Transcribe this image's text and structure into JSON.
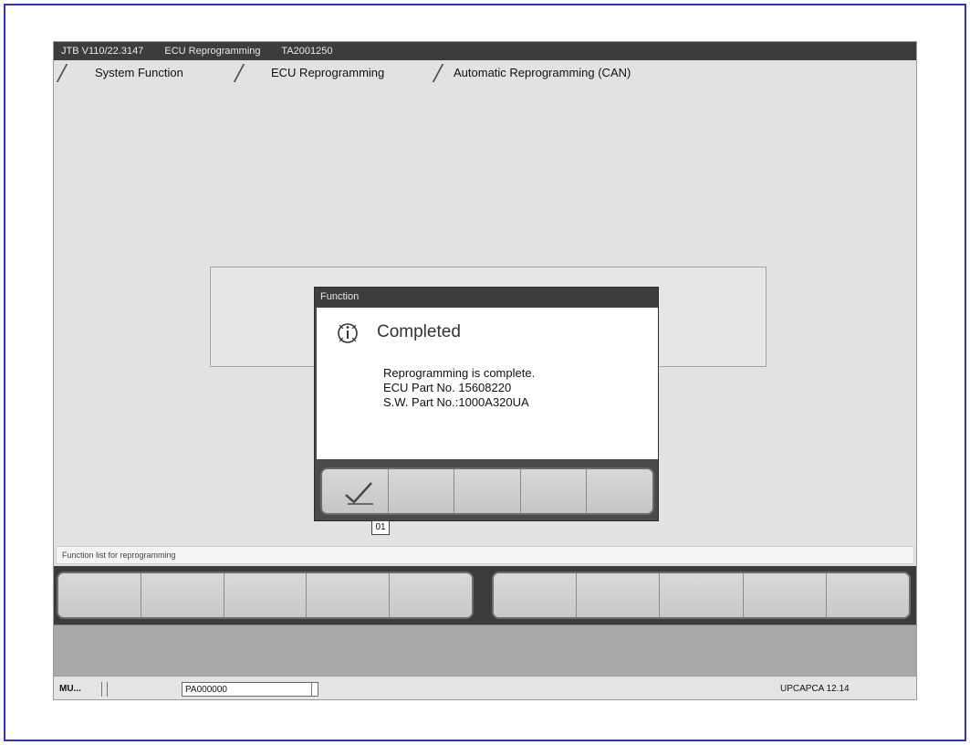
{
  "window": {
    "title_parts": [
      "JTB  V110/22.3147",
      "ECU Reprogramming",
      "TA2001250"
    ]
  },
  "tabs": [
    {
      "label": "System Function"
    },
    {
      "label": "ECU Reprogramming"
    },
    {
      "label": "Automatic Reprogramming (CAN)"
    }
  ],
  "dialog": {
    "title": "Function",
    "heading": "Completed",
    "message": "Reprogramming is complete.\nECU Part No. 15608220\nS.W. Part No.:1000A320UA",
    "ok_icon": "checkmark-icon",
    "ok_tooltip": "01"
  },
  "status_line": {
    "text": "Function list for reprogramming"
  },
  "bottom_bar": {
    "left": "MU...",
    "middle": "PA000000",
    "right": "UPCAPCA  12.14"
  },
  "colors": {
    "frame_border": "#2a32d8",
    "title_bar": "#3c3c3c",
    "workspace": "#e2e2e2"
  }
}
